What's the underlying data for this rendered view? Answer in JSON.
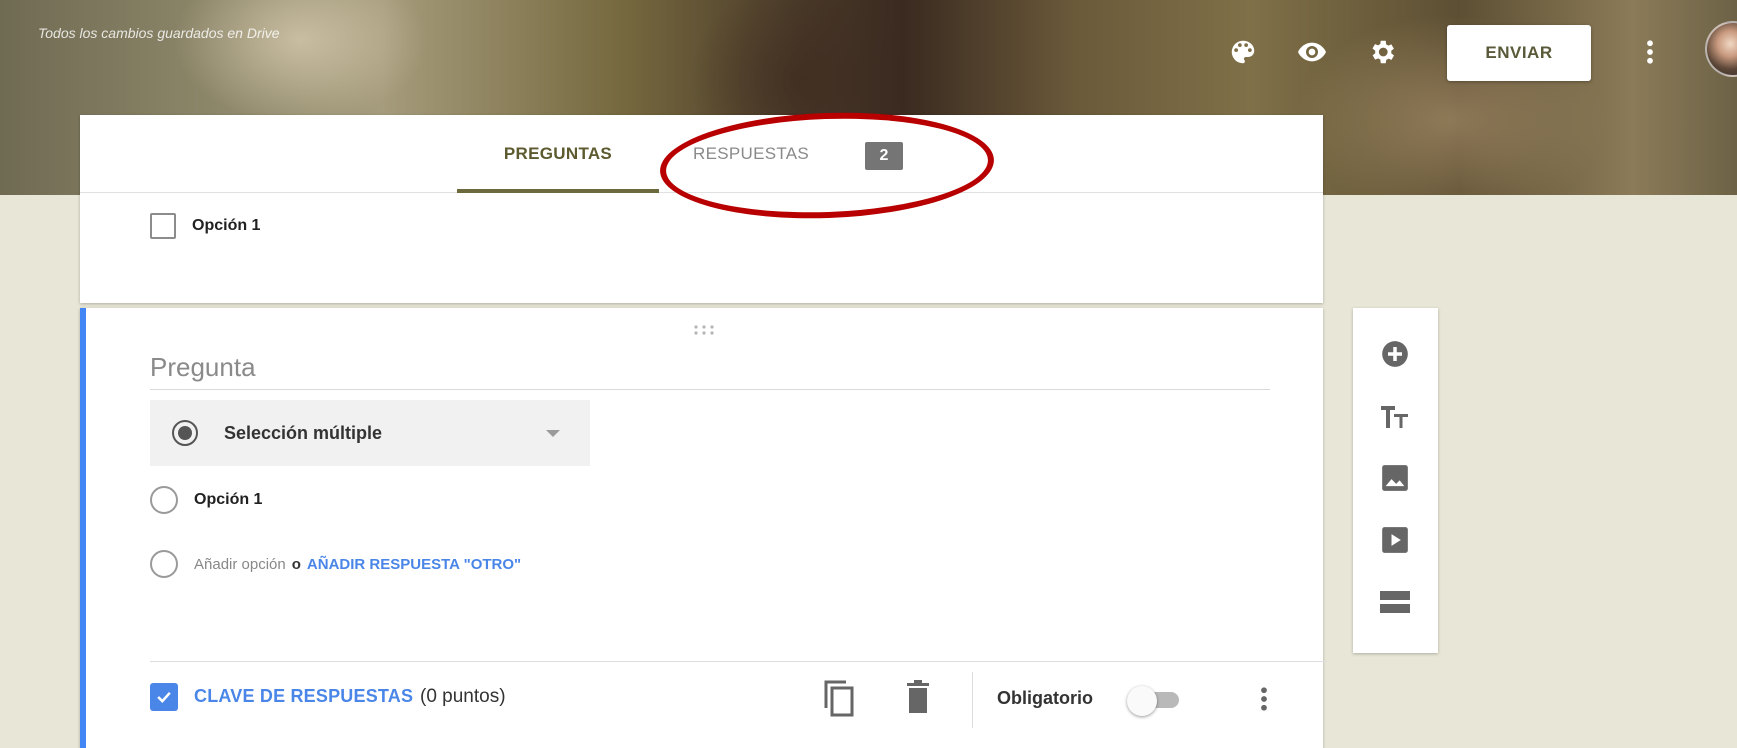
{
  "header": {
    "saved_status": "Todos los cambios guardados en Drive",
    "send_label": "ENVIAR",
    "icons": [
      "palette-icon",
      "eye-icon",
      "gear-icon",
      "more-vert-icon"
    ]
  },
  "tabs": [
    {
      "label": "PREGUNTAS",
      "active": true
    },
    {
      "label": "RESPUESTAS",
      "active": false,
      "badge": "2"
    }
  ],
  "prev_question": {
    "option_label": "Opción 1"
  },
  "question": {
    "title_placeholder": "Pregunta",
    "type_label": "Selección múltiple",
    "option_label": "Opción 1",
    "add_option": "Añadir opción",
    "add_or": "o",
    "add_other": "AÑADIR RESPUESTA \"OTRO\""
  },
  "footer": {
    "answer_key": "CLAVE DE RESPUESTAS",
    "points": "(0 puntos)",
    "required_label": "Obligatorio",
    "required_on": false
  },
  "side_toolbar": [
    "add-question-icon",
    "title-text-icon",
    "image-icon",
    "video-icon",
    "section-icon"
  ],
  "colors": {
    "accent": "#4285f4",
    "link": "#4a86e8",
    "tab_active": "#5c5a2e",
    "background": "#e8e6d6",
    "annotation": "#b80000"
  }
}
